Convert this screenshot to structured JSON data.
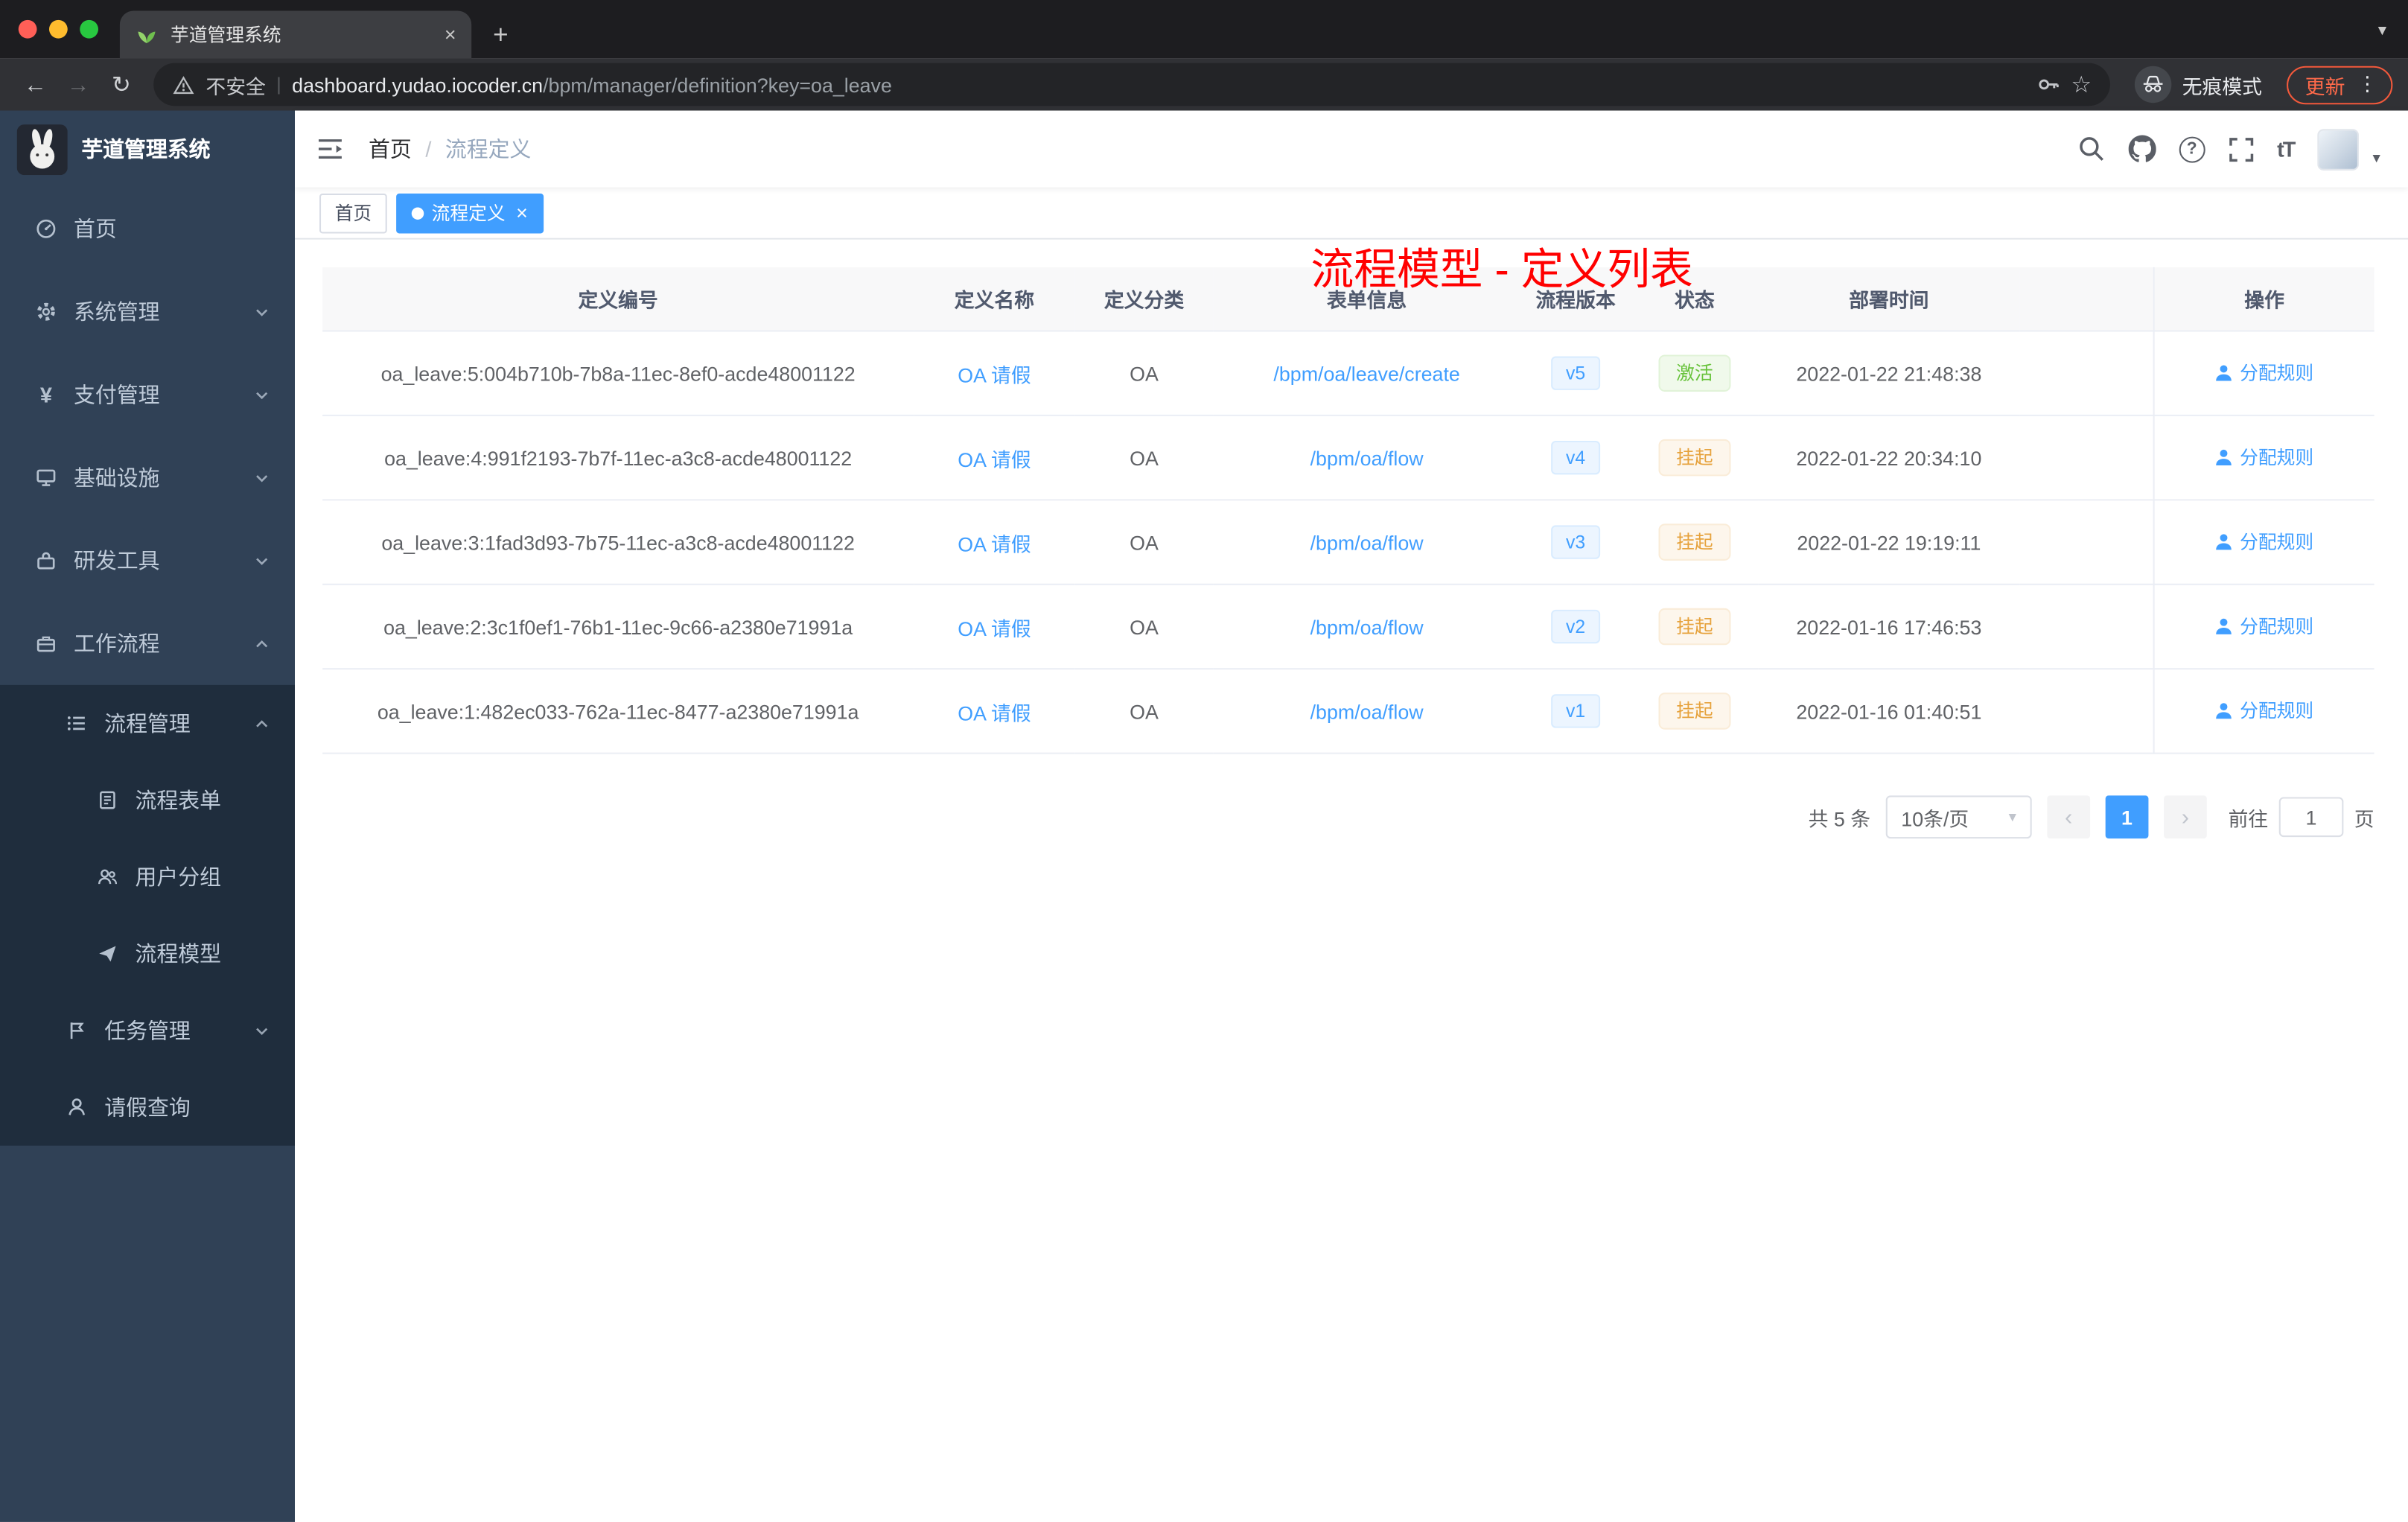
{
  "colors": {
    "accent": "#409eff",
    "success": "#67c23a",
    "warning": "#e6a23c",
    "annotation_red": "#ff0000",
    "sidebar_bg": "#304156",
    "submenu_bg": "#1f2d3d",
    "version_tag_bg": "#ecf5ff",
    "success_tag_bg": "#f0f9eb",
    "warning_tag_bg": "#fdf6ec"
  },
  "icons": {
    "close": "×",
    "plus": "+",
    "tab_search_caret": "▾",
    "back": "←",
    "forward": "→",
    "reload": "↻",
    "star": "☆",
    "menu_dots": "⋮",
    "question": "?",
    "fontsize": "tT",
    "avatar_caret": "▾",
    "select_caret": "▾",
    "prev": "‹",
    "next": "›"
  },
  "browser": {
    "tab_title": "芋道管理系统",
    "security_label": "不安全",
    "url_host": "dashboard.yudao.iocoder.cn",
    "url_path": "/bpm/manager/definition?key=oa_leave",
    "incognito_label": "无痕模式",
    "update_label": "更新"
  },
  "sidebar": {
    "title": "芋道管理系统",
    "items": [
      {
        "label": "首页",
        "icon": "dashboard-icon"
      },
      {
        "label": "系统管理",
        "icon": "gear-icon"
      },
      {
        "label": "支付管理",
        "icon": "yen-icon"
      },
      {
        "label": "基础设施",
        "icon": "monitor-icon"
      },
      {
        "label": "研发工具",
        "icon": "toolbox-icon"
      },
      {
        "label": "工作流程",
        "icon": "briefcase-icon"
      },
      {
        "label": "流程管理",
        "icon": "list-icon"
      },
      {
        "label": "流程表单",
        "icon": "form-icon"
      },
      {
        "label": "用户分组",
        "icon": "users-icon"
      },
      {
        "label": "流程模型",
        "icon": "send-icon"
      },
      {
        "label": "任务管理",
        "icon": "flag-icon"
      },
      {
        "label": "请假查询",
        "icon": "user-icon"
      }
    ]
  },
  "navbar": {
    "breadcrumb_home": "首页",
    "breadcrumb_sep": "/",
    "breadcrumb_current": "流程定义",
    "annotation": "流程模型 - 定义列表"
  },
  "tags": {
    "home": "首页",
    "active": "流程定义"
  },
  "table": {
    "headers": [
      "定义编号",
      "定义名称",
      "定义分类",
      "表单信息",
      "流程版本",
      "状态",
      "部署时间",
      "操作"
    ],
    "rows": [
      {
        "id": "oa_leave:5:004b710b-7b8a-11ec-8ef0-acde48001122",
        "name": "OA 请假",
        "category": "OA",
        "form": "/bpm/oa/leave/create",
        "version": "v5",
        "status": "激活",
        "status_type": "success",
        "time": "2022-01-22 21:48:38",
        "action": "分配规则"
      },
      {
        "id": "oa_leave:4:991f2193-7b7f-11ec-a3c8-acde48001122",
        "name": "OA 请假",
        "category": "OA",
        "form": "/bpm/oa/flow",
        "version": "v4",
        "status": "挂起",
        "status_type": "warning",
        "time": "2022-01-22 20:34:10",
        "action": "分配规则"
      },
      {
        "id": "oa_leave:3:1fad3d93-7b75-11ec-a3c8-acde48001122",
        "name": "OA 请假",
        "category": "OA",
        "form": "/bpm/oa/flow",
        "version": "v3",
        "status": "挂起",
        "status_type": "warning",
        "time": "2022-01-22 19:19:11",
        "action": "分配规则"
      },
      {
        "id": "oa_leave:2:3c1f0ef1-76b1-11ec-9c66-a2380e71991a",
        "name": "OA 请假",
        "category": "OA",
        "form": "/bpm/oa/flow",
        "version": "v2",
        "status": "挂起",
        "status_type": "warning",
        "time": "2022-01-16 17:46:53",
        "action": "分配规则"
      },
      {
        "id": "oa_leave:1:482ec033-762a-11ec-8477-a2380e71991a",
        "name": "OA 请假",
        "category": "OA",
        "form": "/bpm/oa/flow",
        "version": "v1",
        "status": "挂起",
        "status_type": "warning",
        "time": "2022-01-16 01:40:51",
        "action": "分配规则"
      }
    ]
  },
  "pagination": {
    "total": "共 5 条",
    "page_size": "10条/页",
    "page": "1",
    "goto_label": "前往",
    "goto_value": "1",
    "unit": "页"
  }
}
